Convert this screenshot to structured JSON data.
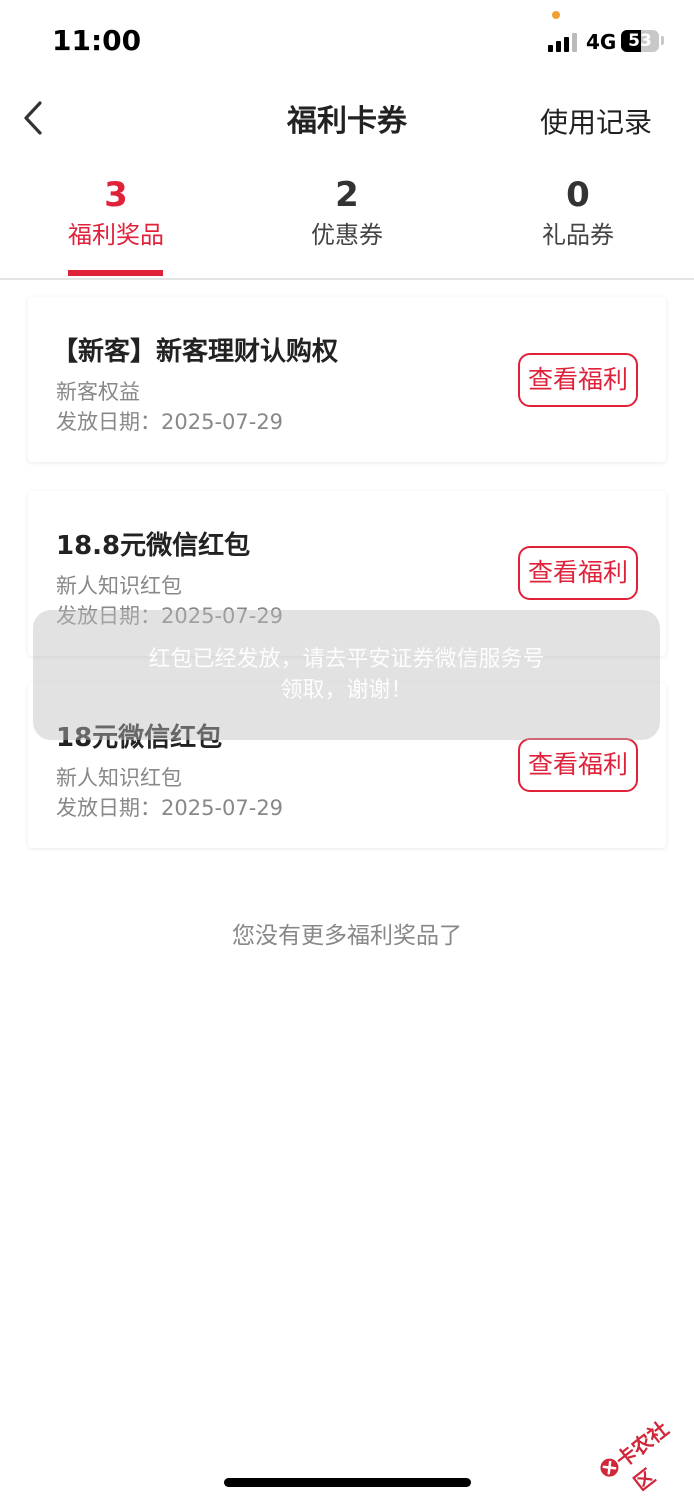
{
  "status_bar": {
    "time": "11:00",
    "network": "4G",
    "battery": "53",
    "battery_level": 0.53
  },
  "nav": {
    "title": "福利卡券",
    "right_action": "使用记录"
  },
  "tabs": [
    {
      "count": "3",
      "label": "福利奖品",
      "active": true
    },
    {
      "count": "2",
      "label": "优惠券",
      "active": false
    },
    {
      "count": "0",
      "label": "礼品券",
      "active": false
    }
  ],
  "cards": [
    {
      "title": "【新客】新客理财认购权",
      "subtitle": "新客权益",
      "date": "发放日期：2025-07-29",
      "button": "查看福利"
    },
    {
      "title": "18.8元微信红包",
      "subtitle": "新人知识红包",
      "date": "发放日期：2025-07-29",
      "button": "查看福利"
    },
    {
      "title": "18元微信红包",
      "subtitle": "新人知识红包",
      "date": "发放日期：2025-07-29",
      "button": "查看福利"
    }
  ],
  "footer_text": "您没有更多福利奖品了",
  "toast": {
    "line1": "红包已经发放，请去平安证券微信服务号",
    "line2": "领取，谢谢！"
  },
  "watermark": "卡农社区",
  "colors": {
    "accent": "#e0213a",
    "text": "#222222",
    "muted": "#888888"
  }
}
